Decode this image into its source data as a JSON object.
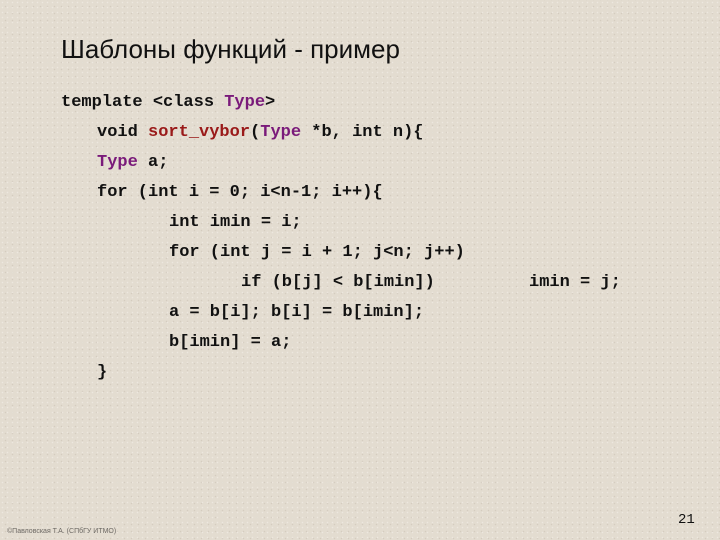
{
  "slide": {
    "title": "Шаблоны функций - пример",
    "code_lines": [
      {
        "parts": [
          {
            "text": "template <class ",
            "style": "plain"
          },
          {
            "text": "Type",
            "style": "type"
          },
          {
            "text": ">",
            "style": "plain"
          }
        ]
      },
      {
        "parts": [
          {
            "text": "void ",
            "style": "plain"
          },
          {
            "text": "sort_vybor",
            "style": "fn"
          },
          {
            "text": "(",
            "style": "plain"
          },
          {
            "text": "Type",
            "style": "type"
          },
          {
            "text": " *b, int n){",
            "style": "plain"
          }
        ]
      },
      {
        "parts": [
          {
            "text": "Type",
            "style": "type"
          },
          {
            "text": " a;",
            "style": "plain"
          }
        ]
      },
      {
        "parts": [
          {
            "text": "for (int i = 0; i<n-1; i++){",
            "style": "plain"
          }
        ]
      },
      {
        "parts": [
          {
            "text": "int imin = i;",
            "style": "plain"
          }
        ]
      },
      {
        "parts": [
          {
            "text": "for (int j = i + 1; j<n; j++)",
            "style": "plain"
          }
        ]
      },
      {
        "parts": [
          {
            "text": "if (b[j] < b[imin])",
            "style": "plain"
          }
        ]
      },
      {
        "parts": [
          {
            "text": "imin = j;",
            "style": "plain"
          }
        ]
      },
      {
        "parts": [
          {
            "text": "a = b[i]; b[i] = b[imin];",
            "style": "plain"
          }
        ]
      },
      {
        "parts": [
          {
            "text": "b[imin] = a;",
            "style": "plain"
          }
        ]
      },
      {
        "parts": [
          {
            "text": "}",
            "style": "plain"
          }
        ]
      }
    ],
    "footer": "©Павловская Т.А. (СПбГУ ИТМО)",
    "page_number": "21"
  },
  "colors": {
    "type_keyword": "#7a1a7a",
    "function_name": "#9a1a1a",
    "text": "#111111",
    "background": "#e3dcd0"
  }
}
